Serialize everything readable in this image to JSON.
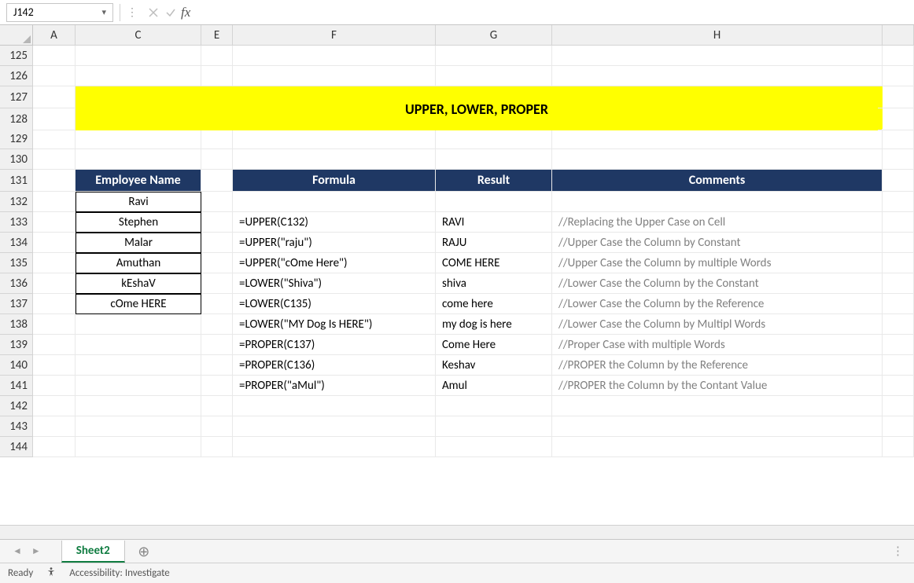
{
  "nameBox": {
    "value": "J142"
  },
  "formulaBar": {
    "fx": "fx",
    "value": ""
  },
  "columns": [
    "A",
    "C",
    "E",
    "F",
    "G",
    "H",
    ""
  ],
  "rowNumbers": [
    "125",
    "126",
    "127",
    "128",
    "129",
    "130",
    "131",
    "132",
    "133",
    "134",
    "135",
    "136",
    "137",
    "138",
    "139",
    "140",
    "141",
    "142",
    "143",
    "144"
  ],
  "banner": "UPPER, LOWER, PROPER",
  "headers": {
    "employee": "Employee Name",
    "formula": "Formula",
    "result": "Result",
    "comments": "Comments"
  },
  "employees": [
    "Ravi",
    "Stephen",
    "Malar",
    "Amuthan",
    "kEshaV",
    "cOme HERE"
  ],
  "formulaRows": [
    {
      "formula": "=UPPER(C132)",
      "result": "RAVI",
      "comment": "//Replacing the Upper Case on Cell"
    },
    {
      "formula": "=UPPER(\"raju\")",
      "result": "RAJU",
      "comment": "//Upper Case the Column by Constant"
    },
    {
      "formula": "=UPPER(\"cOme Here\")",
      "result": "COME HERE",
      "comment": "//Upper Case the Column by multiple Words"
    },
    {
      "formula": "=LOWER(\"Shiva\")",
      "result": "shiva",
      "comment": "//Lower Case the Column by the Constant"
    },
    {
      "formula": "=LOWER(C135)",
      "result": "come here",
      "comment": "//Lower Case the Column by the Reference"
    },
    {
      "formula": "=LOWER(\"MY Dog Is HERE\")",
      "result": "my dog is here",
      "comment": "//Lower Case the Column by Multipl Words"
    },
    {
      "formula": "=PROPER(C137)",
      "result": "Come Here",
      "comment": "//Proper Case with multiple Words"
    },
    {
      "formula": "=PROPER(C136)",
      "result": "Keshav",
      "comment": "//PROPER the Column by the Reference"
    },
    {
      "formula": "=PROPER(\"aMul\")",
      "result": "Amul",
      "comment": "//PROPER the Column by the Contant Value"
    }
  ],
  "sheetTab": "Sheet2",
  "statusBar": {
    "ready": "Ready",
    "accessibility": "Accessibility: Investigate"
  }
}
